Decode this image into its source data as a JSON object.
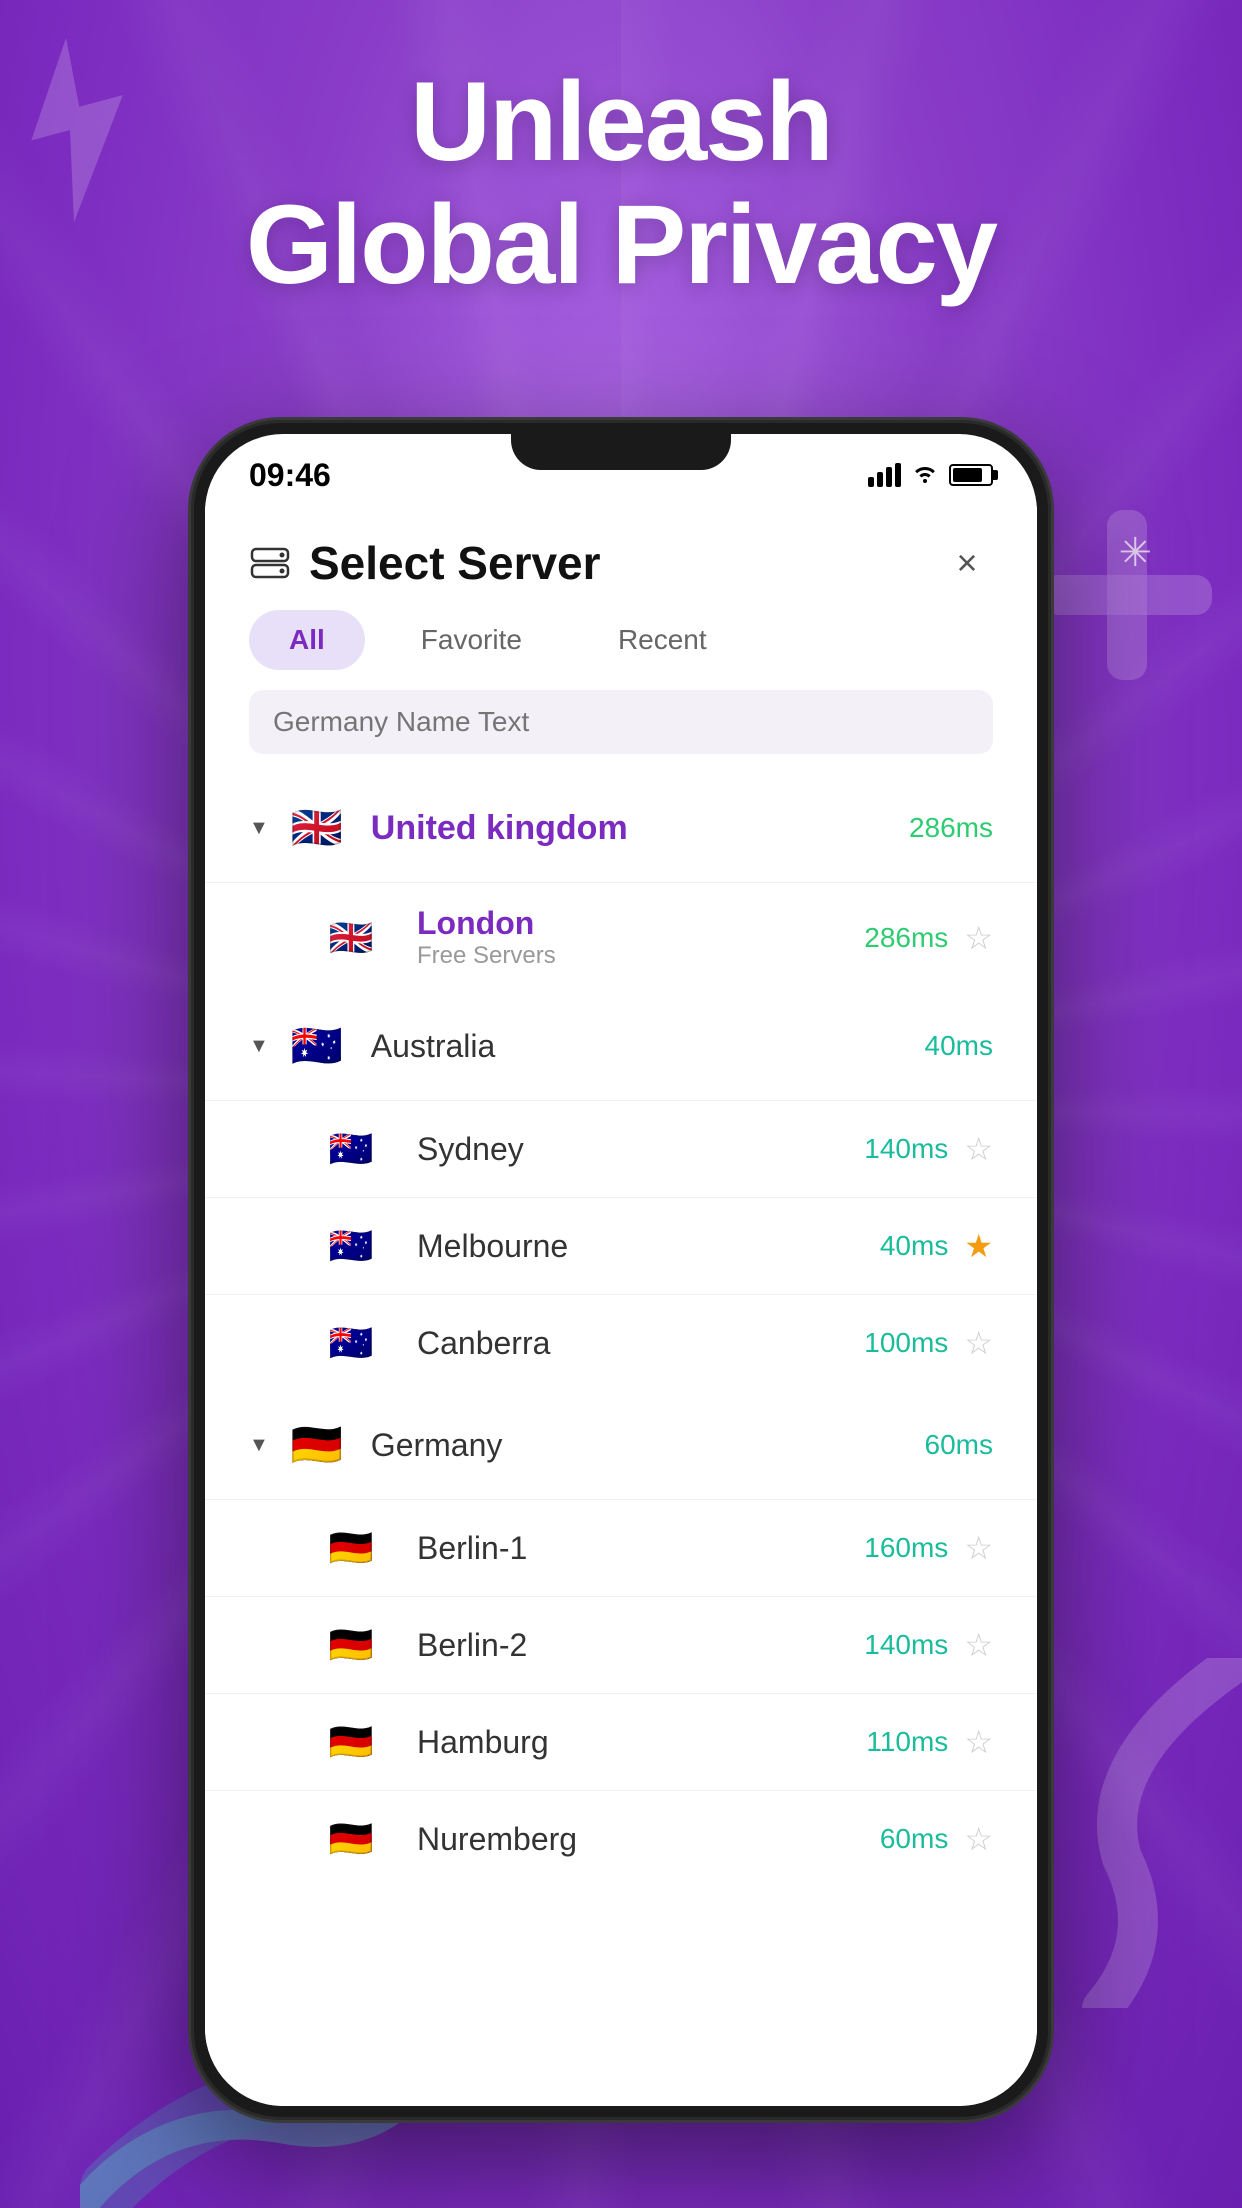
{
  "background": {
    "headline_line1": "Unleash",
    "headline_line2": "Global Privacy",
    "color_primary": "#9B59D4",
    "color_secondary": "#7B2BBF"
  },
  "status_bar": {
    "time": "09:46"
  },
  "header": {
    "title": "Select Server",
    "close_label": "×"
  },
  "tabs": [
    {
      "id": "all",
      "label": "All",
      "active": true
    },
    {
      "id": "favorite",
      "label": "Favorite",
      "active": false
    },
    {
      "id": "recent",
      "label": "Recent",
      "active": false
    }
  ],
  "search": {
    "placeholder": "Germany Name Text"
  },
  "countries": [
    {
      "name": "United kingdom",
      "flag": "🇬🇧",
      "flag_type": "uk",
      "latency": "286ms",
      "latency_color": "green",
      "expanded": true,
      "cities": [
        {
          "name": "London",
          "sub": "Free Servers",
          "latency": "286ms",
          "latency_color": "green",
          "starred": false
        }
      ]
    },
    {
      "name": "Australia",
      "flag": "🇦🇺",
      "flag_type": "au",
      "latency": "40ms",
      "latency_color": "teal",
      "expanded": true,
      "cities": [
        {
          "name": "Sydney",
          "sub": "",
          "latency": "140ms",
          "latency_color": "teal",
          "starred": false
        },
        {
          "name": "Melbourne",
          "sub": "",
          "latency": "40ms",
          "latency_color": "teal",
          "starred": true
        },
        {
          "name": "Canberra",
          "sub": "",
          "latency": "100ms",
          "latency_color": "teal",
          "starred": false
        }
      ]
    },
    {
      "name": "Germany",
      "flag": "🇩🇪",
      "flag_type": "de",
      "latency": "60ms",
      "latency_color": "teal",
      "expanded": true,
      "cities": [
        {
          "name": "Berlin-1",
          "sub": "",
          "latency": "160ms",
          "latency_color": "teal",
          "starred": false
        },
        {
          "name": "Berlin-2",
          "sub": "",
          "latency": "140ms",
          "latency_color": "teal",
          "starred": false
        },
        {
          "name": "Hamburg",
          "sub": "",
          "latency": "110ms",
          "latency_color": "teal",
          "starred": false
        },
        {
          "name": "Nuremberg",
          "sub": "",
          "latency": "60ms",
          "latency_color": "teal",
          "starred": false
        }
      ]
    }
  ]
}
